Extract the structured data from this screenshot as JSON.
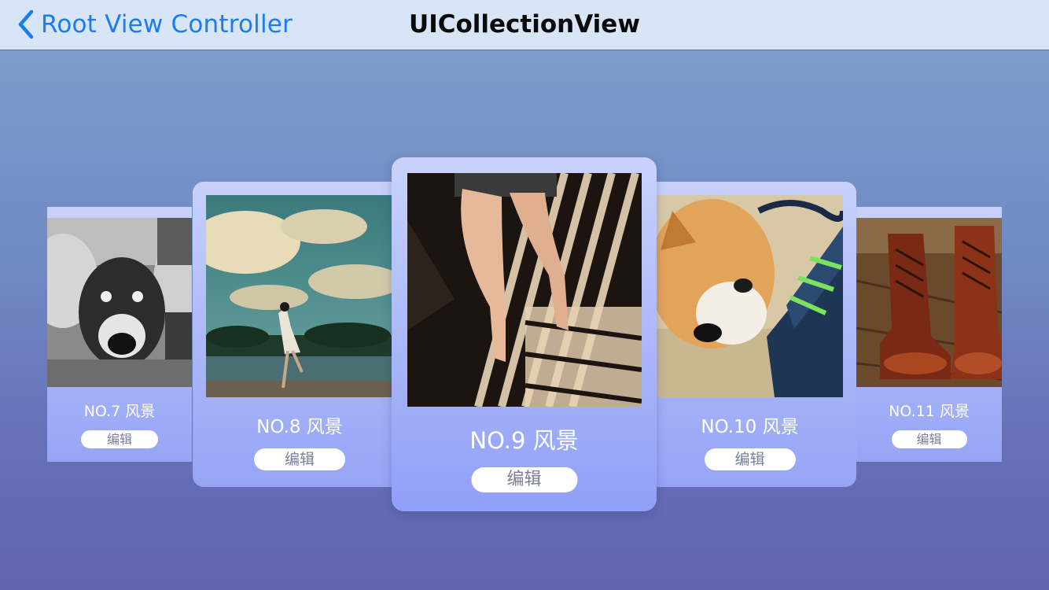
{
  "navbar": {
    "back_label": "Root View Controller",
    "title": "UICollectionView"
  },
  "cards": [
    {
      "caption": "NO.7 风景",
      "edit_label": "编辑",
      "photo": "dog-with-two-people-bw"
    },
    {
      "caption": "NO.8 风景",
      "edit_label": "编辑",
      "photo": "girl-running-by-lake"
    },
    {
      "caption": "NO.9 风景",
      "edit_label": "编辑",
      "photo": "legs-on-fire-escape"
    },
    {
      "caption": "NO.10 风景",
      "edit_label": "编辑",
      "photo": "puppy-and-sneaker"
    },
    {
      "caption": "NO.11 风景",
      "edit_label": "编辑",
      "photo": "leather-boots-on-wood"
    }
  ],
  "colors": {
    "nav_background": "#d8e5f6",
    "back_tint": "#1b7cf2",
    "card_top": "#c7d1fb",
    "card_bottom": "#97a4f6"
  }
}
